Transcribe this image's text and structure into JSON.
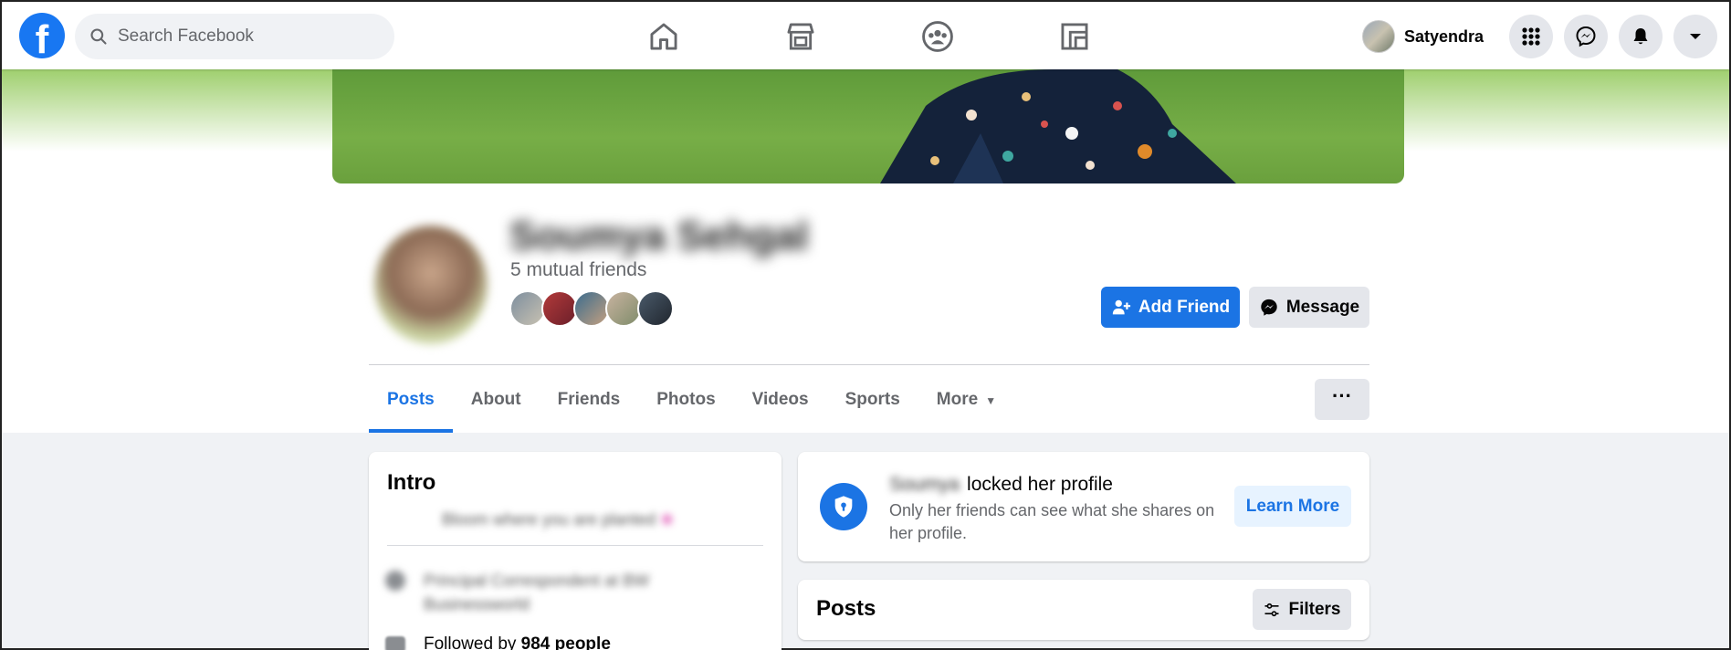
{
  "topbar": {
    "search_placeholder": "Search Facebook",
    "user_name": "Satyendra",
    "nav_icons": [
      "home-icon",
      "marketplace-icon",
      "groups-icon",
      "gaming-icon"
    ],
    "right_icons": [
      "menu-grid-icon",
      "messenger-icon",
      "notifications-icon",
      "account-caret-icon"
    ]
  },
  "profile": {
    "name": "Soumya Sehgal",
    "mutual_friends": "5 mutual friends",
    "add_friend_label": "Add Friend",
    "message_label": "Message",
    "more_options_label": "···"
  },
  "tabs": [
    {
      "label": "Posts",
      "active": true
    },
    {
      "label": "About",
      "active": false
    },
    {
      "label": "Friends",
      "active": false
    },
    {
      "label": "Photos",
      "active": false
    },
    {
      "label": "Videos",
      "active": false
    },
    {
      "label": "Sports",
      "active": false
    },
    {
      "label": "More",
      "active": false
    }
  ],
  "intro": {
    "title": "Intro",
    "bio": "Bloom where you are planted",
    "work": "Principal Correspondent at BW Businessworld",
    "followed_prefix": "Followed by ",
    "followed_count": "984 people"
  },
  "locked": {
    "name": "Soumya",
    "title": "locked her profile",
    "description": "Only her friends can see what she shares on her profile.",
    "learn_more_label": "Learn More"
  },
  "posts": {
    "title": "Posts",
    "filters_label": "Filters"
  },
  "colors": {
    "brand_blue": "#1b74e4",
    "light_blue": "#e7f3ff",
    "gray_button": "#e4e6eb",
    "page_bg": "#f0f2f5"
  }
}
